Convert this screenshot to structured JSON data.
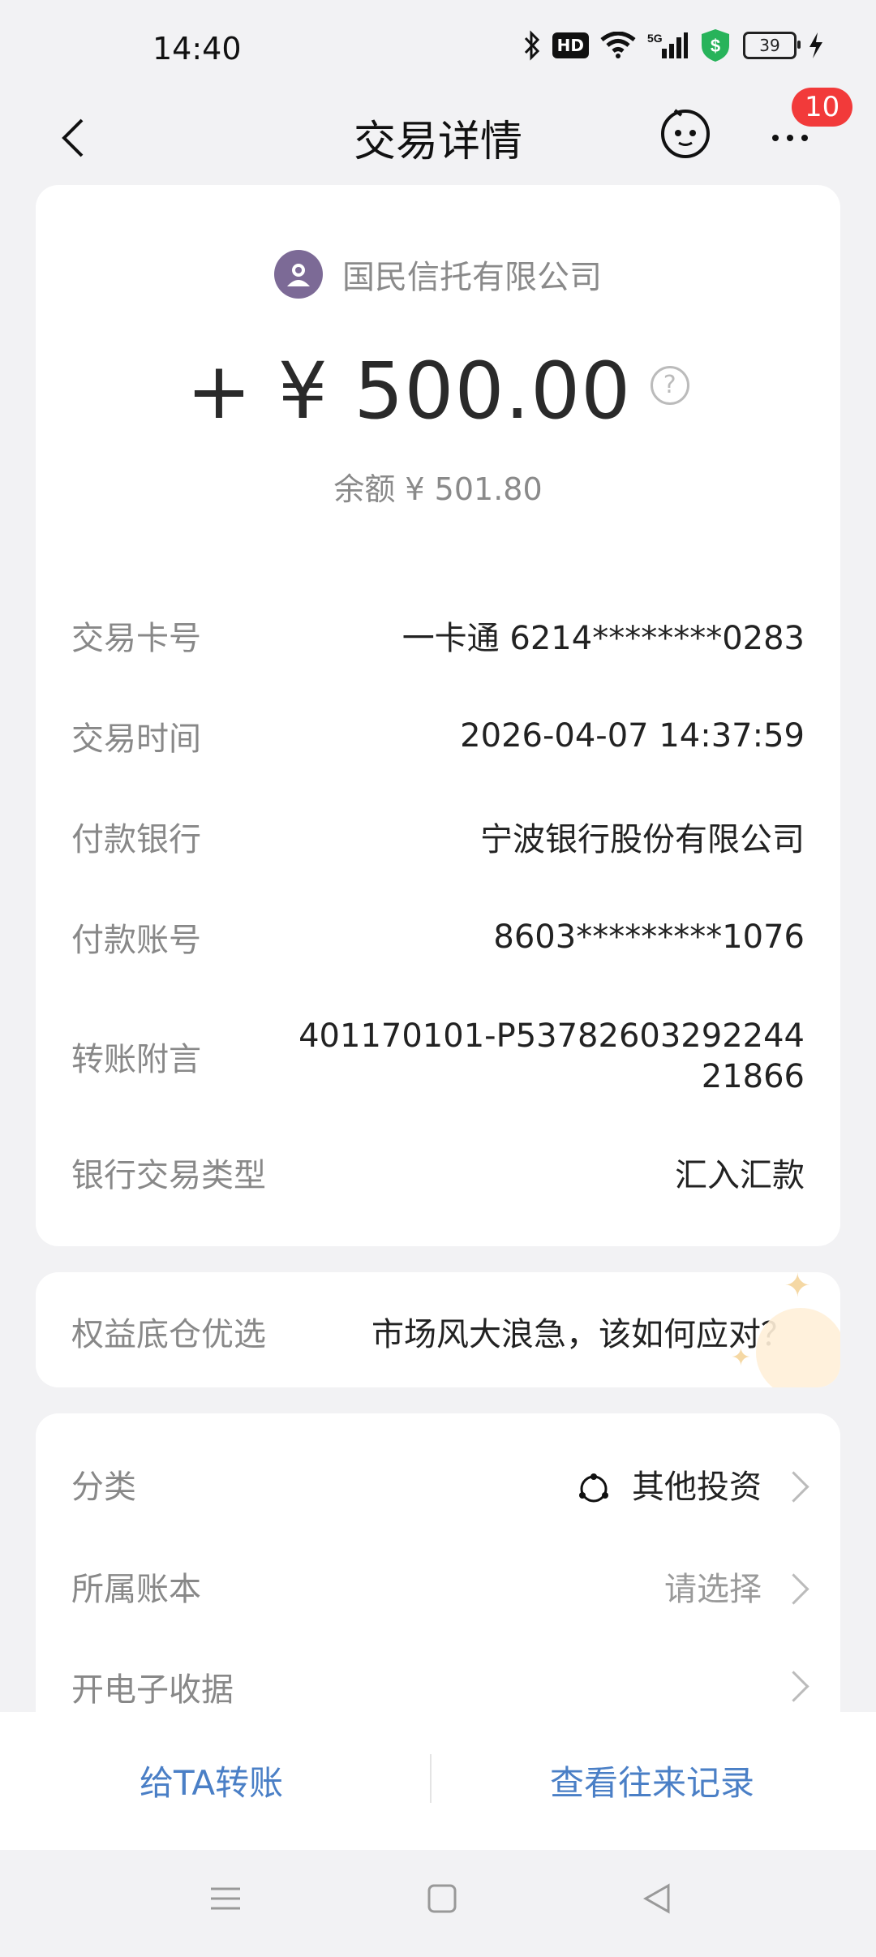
{
  "status_bar": {
    "time": "14:40",
    "battery": "39"
  },
  "nav": {
    "title": "交易详情",
    "notification_count": "10"
  },
  "transaction": {
    "payee": "国民信托有限公司",
    "amount": "+ ¥ 500.00",
    "balance": "余额 ¥ 501.80"
  },
  "details": [
    {
      "label": "交易卡号",
      "value": "一卡通 6214********0283"
    },
    {
      "label": "交易时间",
      "value": "2026-04-07 14:37:59"
    },
    {
      "label": "付款银行",
      "value": "宁波银行股份有限公司"
    },
    {
      "label": "付款账号",
      "value": "8603*********1076"
    },
    {
      "label": "转账附言",
      "value_line1": "401170101-P53782603292244",
      "value_line2": "21866"
    },
    {
      "label": "银行交易类型",
      "value": "汇入汇款"
    }
  ],
  "promo": {
    "label": "权益底仓优选",
    "text": "市场风大浪急，该如何应对？"
  },
  "options": [
    {
      "label": "分类",
      "value": "其他投资"
    },
    {
      "label": "所属账本",
      "value": "请选择"
    },
    {
      "label": "开电子收据",
      "value": ""
    }
  ],
  "actions": {
    "transfer": "给TA转账",
    "history": "查看往来记录"
  },
  "colors": {
    "accent_blue": "#4a7fc6",
    "badge_red": "#f23a3a"
  }
}
